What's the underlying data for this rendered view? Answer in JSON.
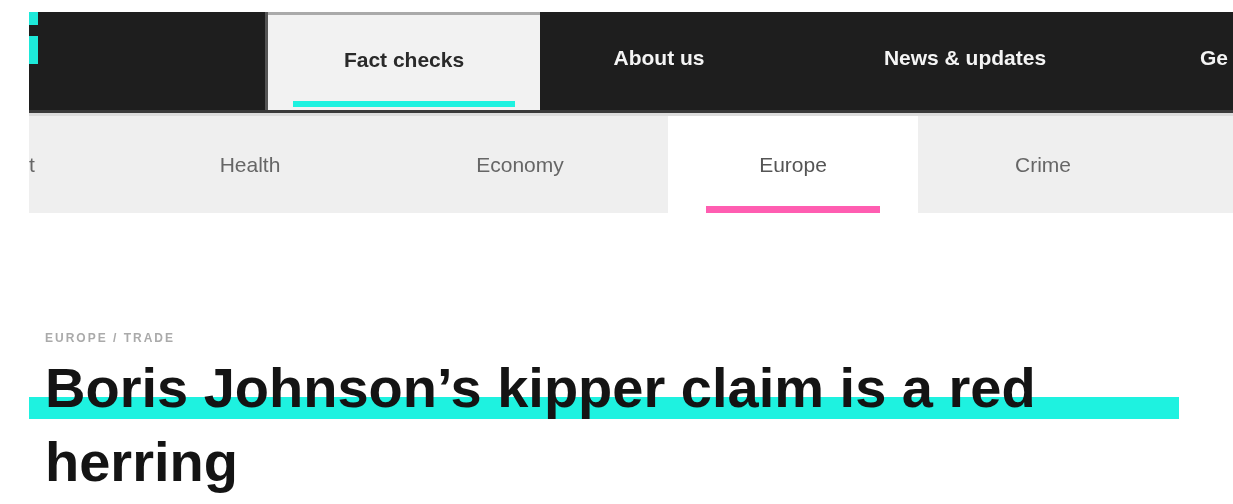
{
  "main_nav": [
    {
      "label": "Fact checks",
      "selected": true
    },
    {
      "label": "About us",
      "selected": false
    },
    {
      "label": "News & updates",
      "selected": false
    },
    {
      "label": "Ge",
      "selected": false
    }
  ],
  "section_nav": [
    {
      "label": "t",
      "selected": false
    },
    {
      "label": "Health",
      "selected": false
    },
    {
      "label": "Economy",
      "selected": false
    },
    {
      "label": "Europe",
      "selected": true
    },
    {
      "label": "Crime",
      "selected": false
    }
  ],
  "breadcrumb": "EUROPE / TRADE",
  "headline": "Boris Johnson’s kipper claim is a red herring"
}
